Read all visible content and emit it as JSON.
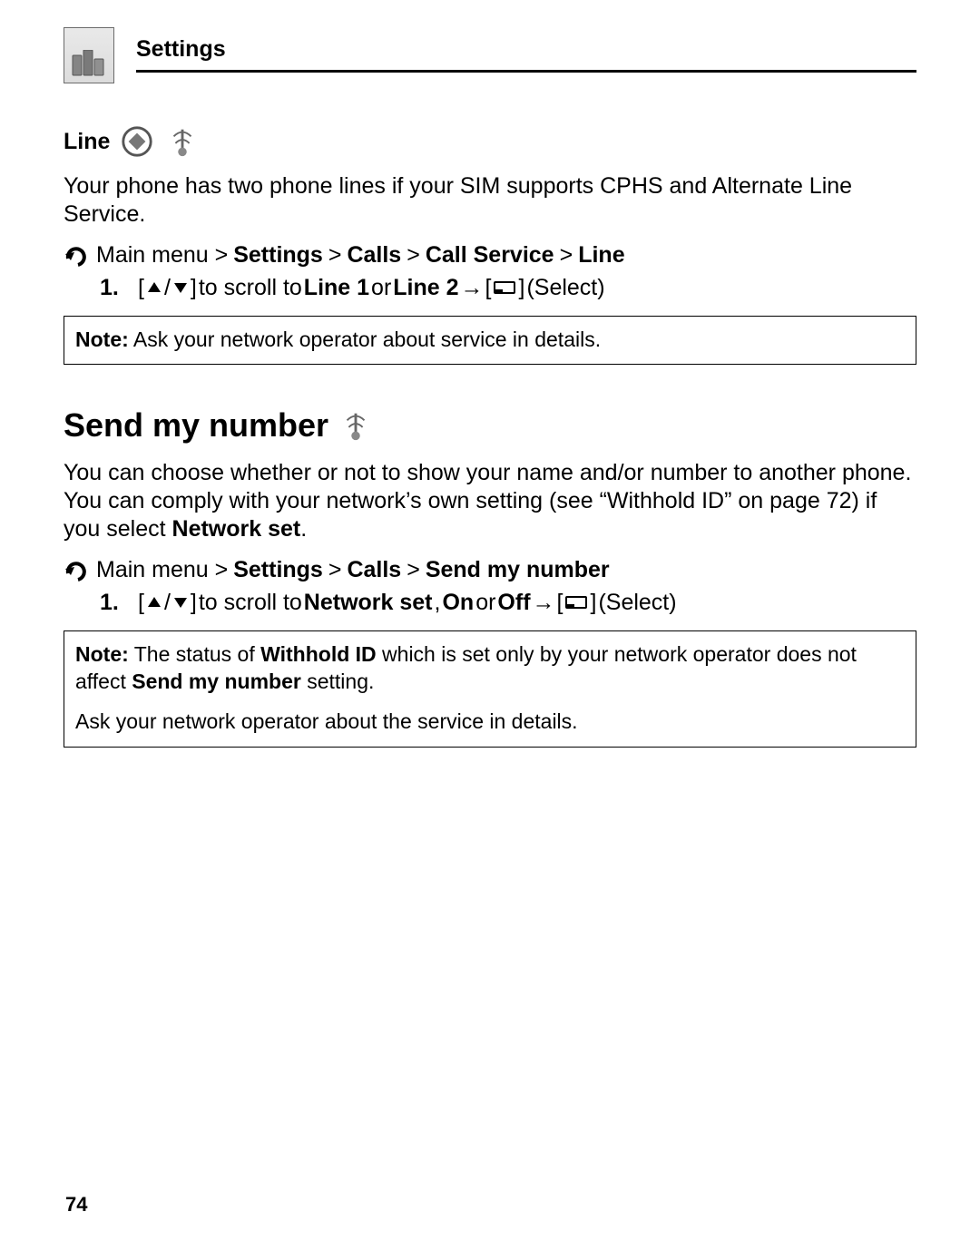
{
  "header": {
    "title": "Settings"
  },
  "section_line": {
    "heading": "Line",
    "paragraph": "Your phone has two phone lines if your SIM supports CPHS and Alternate Line Service.",
    "nav": {
      "prefix": "Main menu >",
      "b1": "Settings",
      "sep": ">",
      "b2": "Calls",
      "b3": "Call Service",
      "b4": "Line"
    },
    "step": {
      "num": "1.",
      "lbracket": "[",
      "slash": "/",
      "rbracket": "]",
      "t1": " to scroll to ",
      "opt1": "Line 1",
      "or": " or ",
      "opt2": "Line 2",
      "arrow": " → ",
      "lbracket2": "[",
      "rbracket2": "]",
      "select": " (Select)"
    },
    "note": {
      "label": "Note:",
      "text": " Ask your network operator about service in details."
    }
  },
  "section_send": {
    "heading": "Send my number",
    "para": {
      "t1": "You can choose whether or not to show your name and/or number to another phone. You can comply with your network’s own setting (see “Withhold ID” on page 72) if you select ",
      "b1": "Network set",
      "t2": "."
    },
    "nav": {
      "prefix": "Main menu >",
      "b1": "Settings",
      "sep": ">",
      "b2": "Calls",
      "b3": "Send my number"
    },
    "step": {
      "num": "1.",
      "lbracket": "[",
      "slash": "/",
      "rbracket": "]",
      "t1": " to scroll to ",
      "opt1": "Network set",
      "comma": ", ",
      "opt2": "On",
      "or": " or ",
      "opt3": "Off",
      "arrow": " → ",
      "lbracket2": "[",
      "rbracket2": "]",
      "select": " (Select)"
    },
    "note": {
      "p1_a": "Note:",
      "p1_b": " The status of ",
      "p1_c": "Withhold ID",
      "p1_d": " which is set only by your network operator does not affect ",
      "p1_e": "Send my number",
      "p1_f": " setting.",
      "p2": "Ask your network operator about the service in details."
    }
  },
  "footer": {
    "page_number": "74"
  }
}
